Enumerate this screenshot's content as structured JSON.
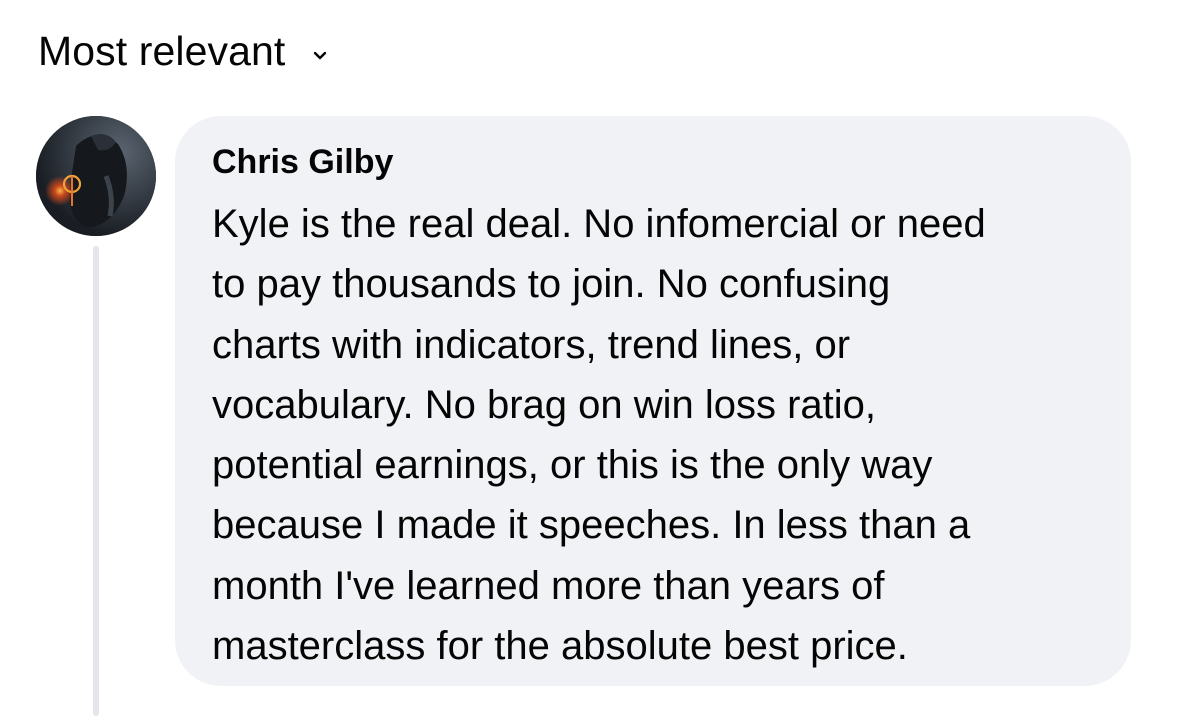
{
  "sort": {
    "label": "Most relevant",
    "icon": "chevron-down-icon"
  },
  "comment": {
    "author": "Chris Gilby",
    "avatar_icon": "user-avatar",
    "lines": [
      "Kyle is the real deal. No infomercial or need",
      "to pay thousands to join. No confusing",
      "charts with indicators, trend lines, or",
      "vocabulary. No brag on win loss ratio,",
      "potential earnings, or this is the only way",
      "because I made it speeches. In less than a",
      "month I've learned more than years of",
      "masterclass for the absolute best price."
    ]
  },
  "colors": {
    "bubble_bg": "#f0f2f5",
    "text": "#050505",
    "thread_line": "#e4e6eb"
  }
}
